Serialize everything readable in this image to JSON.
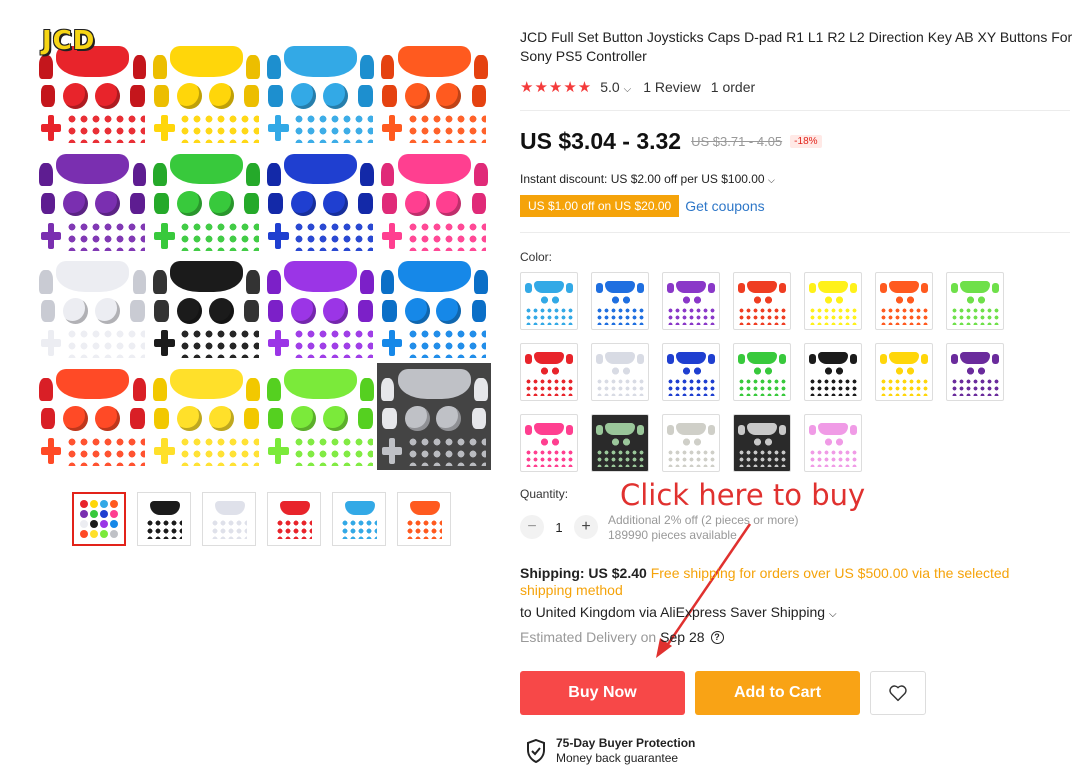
{
  "gallery": {
    "brand_logo_text": "JCD",
    "kits": [
      {
        "color": "#e8242b",
        "accent": "#c4161c"
      },
      {
        "color": "#ffd60a",
        "accent": "#ecbe00"
      },
      {
        "color": "#33a9e6",
        "accent": "#1d8fcf"
      },
      {
        "color": "#ff5a1f",
        "accent": "#e54210"
      },
      {
        "color": "#7a2fb0",
        "accent": "#5e1d91"
      },
      {
        "color": "#38c93c",
        "accent": "#25a92a"
      },
      {
        "color": "#1f3fd0",
        "accent": "#1329a8"
      },
      {
        "color": "#ff3f90",
        "accent": "#e02a78"
      },
      {
        "color": "#ecedf2",
        "accent": "#c9cbd3"
      },
      {
        "color": "#1b1b1b",
        "accent": "#333333"
      },
      {
        "color": "#9b35e6",
        "accent": "#7c20c8"
      },
      {
        "color": "#1688e8",
        "accent": "#0b6fc7"
      },
      {
        "color": "#ff4a26",
        "accent": "#d91f26"
      },
      {
        "color": "#ffe02a",
        "accent": "#f2c800"
      },
      {
        "color": "#7bea3a",
        "accent": "#55d020"
      },
      {
        "color": "#bfc1c6",
        "accent": "#e6e7ea",
        "clear": true
      }
    ],
    "thumbnails": [
      {
        "color": "#e8242b",
        "active": true,
        "multi": true
      },
      {
        "color": "#1b1b1b"
      },
      {
        "color": "#dfe1ea"
      },
      {
        "color": "#e8242b"
      },
      {
        "color": "#33a9e6"
      },
      {
        "color": "#ff5a1f"
      }
    ]
  },
  "product": {
    "title": "JCD Full Set Button Joysticks Caps D-pad R1 L1 R2 L2 Direction Key AB XY Buttons For Sony PS5 Controller",
    "stars": "★★★★★",
    "rating": "5.0",
    "reviews": "1 Review",
    "orders": "1 order",
    "price": "US $3.04 - 3.32",
    "old_price": "US $3.71 - 4.05",
    "discount": "-18%",
    "instant_discount": "Instant discount: US $2.00 off per US $100.00",
    "coupon_tag": "US $1.00 off on US $20.00",
    "get_coupons": "Get coupons",
    "color_label": "Color:",
    "swatches": [
      {
        "color": "#33a9e6"
      },
      {
        "color": "#1f6fe0"
      },
      {
        "color": "#8a38c8"
      },
      {
        "color": "#ef3d22"
      },
      {
        "color": "#fff11a"
      },
      {
        "color": "#ff5a1f"
      },
      {
        "color": "#6fe04a"
      },
      {
        "color": "#e8242b"
      },
      {
        "color": "#d8dbe4"
      },
      {
        "color": "#1f3fd0"
      },
      {
        "color": "#38c93c"
      },
      {
        "color": "#1b1b1b"
      },
      {
        "color": "#ffd60a"
      },
      {
        "color": "#6a2b9c"
      },
      {
        "color": "#ff3f90"
      },
      {
        "color": "#9ac79a",
        "dark": true
      },
      {
        "color": "#cfcfc8"
      },
      {
        "color": "#c8c8c8",
        "dark": true
      },
      {
        "color": "#f09be6"
      }
    ],
    "quantity_label": "Quantity:",
    "quantity_value": "1",
    "qty_minus": "−",
    "qty_plus": "+",
    "qty_note_1": "Additional 2% off (2 pieces or more)",
    "qty_note_2": "189990 pieces available",
    "annotation": "Click here to buy",
    "shipping_label": "Shipping: US $2.40",
    "shipping_free": "Free shipping for orders over US $500.00 via the selected shipping method",
    "ship_to": "to United Kingdom via AliExpress Saver Shipping",
    "est_label": "Estimated Delivery on",
    "est_date": "Sep 28",
    "buy_now": "Buy Now",
    "add_to_cart": "Add to Cart",
    "protection_title": "75-Day Buyer Protection",
    "protection_sub": "Money back guarantee"
  },
  "colors": {
    "accent_red": "#f74848",
    "accent_orange": "#f9a315",
    "link_blue": "#2e77c8",
    "star_red": "#f43b3b"
  }
}
